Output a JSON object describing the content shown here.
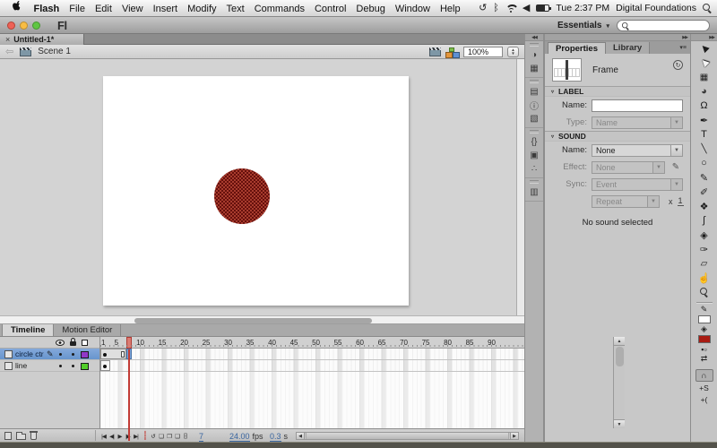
{
  "menubar": {
    "items": [
      "Flash",
      "File",
      "Edit",
      "View",
      "Insert",
      "Modify",
      "Text",
      "Commands",
      "Control",
      "Debug",
      "Window",
      "Help"
    ],
    "time": "Tue 2:37 PM",
    "account": "Digital Foundations",
    "icon_glyphs": {
      "time_machine": "↺",
      "bluetooth": "ᛒ",
      "volume": "◀"
    }
  },
  "titlebar": {
    "logo": "Fl",
    "workspace": "Essentials",
    "caret": "▾"
  },
  "document": {
    "tab_label": "Untitled-1*",
    "close_glyph": "×"
  },
  "editbar": {
    "back_glyph": "⇦",
    "scene_label": "Scene 1",
    "zoom_value": "100%",
    "stepper_up": "▲",
    "stepper_down": "▼"
  },
  "stage": {
    "circle": {
      "fill_a": "#A83C2E",
      "fill_b": "#66100C"
    }
  },
  "dock": {
    "collapse_glyph": "◀◀",
    "icons": [
      {
        "name": "color-panel-icon",
        "glyph": "◑"
      },
      {
        "name": "swatches-panel-icon",
        "glyph": "▦"
      },
      {
        "name": "align-panel-icon",
        "glyph": "▤"
      },
      {
        "name": "info-panel-icon",
        "glyph": "ⓘ"
      },
      {
        "name": "transform-panel-icon",
        "glyph": "▧"
      },
      {
        "name": "code-snippets-panel-icon",
        "glyph": "{}"
      },
      {
        "name": "components-panel-icon",
        "glyph": "▣"
      },
      {
        "name": "motion-presets-panel-icon",
        "glyph": "∴"
      },
      {
        "name": "project-panel-icon",
        "glyph": "▥"
      }
    ],
    "groups": [
      [
        0,
        1
      ],
      [
        2,
        3,
        4
      ],
      [
        5,
        6,
        7
      ],
      [
        8
      ]
    ]
  },
  "properties": {
    "expand_glyph": "▶▶",
    "tabs": [
      "Properties",
      "Library"
    ],
    "panel_menu_glyph": "▾≡",
    "selection_type": "Frame",
    "help_glyph": "↻",
    "label_section": {
      "title": "LABEL",
      "disclosure": "▿",
      "name_label": "Name:",
      "name_value": "",
      "type_label": "Type:",
      "type_value": "Name"
    },
    "sound_section": {
      "title": "SOUND",
      "disclosure": "▿",
      "name_label": "Name:",
      "name_value": "None",
      "effect_label": "Effect:",
      "effect_value": "None",
      "pencil_glyph": "✎",
      "sync_label": "Sync:",
      "sync_value": "Event",
      "repeat_value": "Repeat",
      "multiplier_label": "x",
      "multiplier_value": "1",
      "status": "No sound selected"
    }
  },
  "tools": {
    "expand_glyph": "▶▶",
    "items": [
      {
        "name": "selection-tool",
        "glyph": "▶"
      },
      {
        "name": "subselection-tool",
        "glyph": "▶"
      },
      {
        "name": "free-transform-tool",
        "glyph": "▦"
      },
      {
        "name": "3d-rotation-tool",
        "glyph": "◕"
      },
      {
        "name": "lasso-tool",
        "glyph": "Ω"
      },
      {
        "name": "pen-tool",
        "glyph": "✒"
      },
      {
        "name": "text-tool",
        "glyph": "T"
      },
      {
        "name": "line-tool",
        "glyph": "╲"
      },
      {
        "name": "oval-tool",
        "glyph": "○"
      },
      {
        "name": "pencil-tool",
        "glyph": "✎"
      },
      {
        "name": "brush-tool",
        "glyph": "✐"
      },
      {
        "name": "deco-tool",
        "glyph": "❖"
      },
      {
        "name": "bone-tool",
        "glyph": "ʃ"
      },
      {
        "name": "paint-bucket-tool",
        "glyph": "◈"
      },
      {
        "name": "eyedropper-tool",
        "glyph": "✑"
      },
      {
        "name": "eraser-tool",
        "glyph": "▱"
      },
      {
        "name": "hand-tool",
        "glyph": "☝"
      },
      {
        "name": "zoom-tool",
        "glyph": ""
      }
    ],
    "stroke_color": "#FFFFFF",
    "fill_color": "#A91C13",
    "stroke_pencil_glyph": "✎",
    "bucket_glyph": "◈",
    "bw_glyph": "▪▫",
    "swap_glyph": "⇄",
    "options": [
      {
        "name": "snap-to-objects-button",
        "glyph": "∩"
      },
      {
        "name": "smooth-button",
        "glyph": "+S"
      },
      {
        "name": "straighten-button",
        "glyph": "+("
      }
    ]
  },
  "timeline": {
    "tabs": [
      "Timeline",
      "Motion Editor"
    ],
    "layers": [
      {
        "name": "circle ctr",
        "color": "#9137C8",
        "selected": true
      },
      {
        "name": "line",
        "color": "#52CE29",
        "selected": false
      }
    ],
    "ruler_numbers": [
      1,
      5,
      10,
      15,
      20,
      25,
      30,
      35,
      40,
      45,
      50,
      55,
      60,
      65,
      70,
      75,
      80,
      85,
      90
    ],
    "playhead_frame": 7,
    "playback": [
      {
        "name": "go-to-first-frame-button",
        "glyph": "|◀"
      },
      {
        "name": "step-back-button",
        "glyph": "◀|"
      },
      {
        "name": "play-button",
        "glyph": "▶"
      },
      {
        "name": "step-forward-button",
        "glyph": "|▶"
      },
      {
        "name": "go-to-last-frame-button",
        "glyph": "▶|"
      }
    ],
    "onion": [
      {
        "name": "center-frame-button",
        "glyph": "┆",
        "red": true
      },
      {
        "name": "loop-button",
        "glyph": "↺"
      },
      {
        "name": "onion-skin-button",
        "glyph": "❏"
      },
      {
        "name": "onion-skin-outlines-button",
        "glyph": "❐"
      },
      {
        "name": "edit-multiple-frames-button",
        "glyph": "❑"
      },
      {
        "name": "modify-markers-button",
        "glyph": "[·]"
      }
    ],
    "status": {
      "frame": "7",
      "fps_value": "24.00",
      "fps_unit": "fps",
      "time_value": "0.3",
      "time_unit": "s"
    }
  }
}
